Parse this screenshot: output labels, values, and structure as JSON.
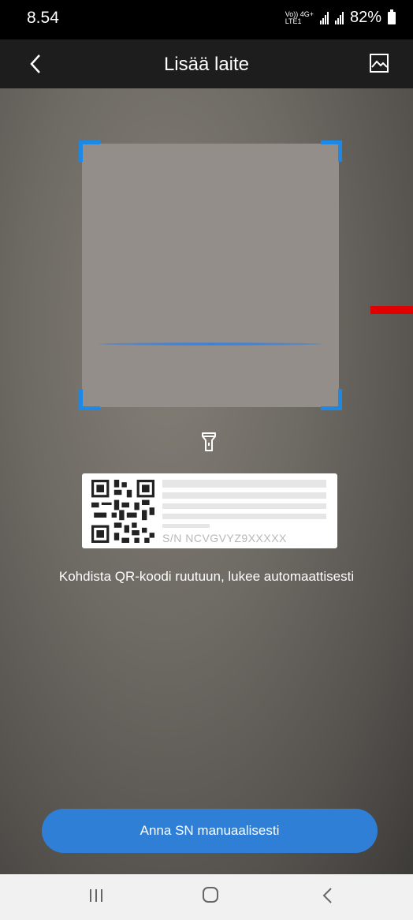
{
  "status_bar": {
    "time": "8.54",
    "network_top": "Vo)) 4G+",
    "network_bottom": "LTE1",
    "battery": "82%"
  },
  "app_bar": {
    "title": "Lisää laite",
    "back_icon": "chevron-left-icon",
    "gallery_icon": "image-icon"
  },
  "scanner": {
    "flashlight_icon": "flashlight-icon"
  },
  "sample_label": {
    "sn_text": "S/N  NCVGVYZ9XXXXX"
  },
  "hint": {
    "text": "Kohdista QR-koodi ruutuun, lukee automaattisesti"
  },
  "manual_button": {
    "label": "Anna SN manuaalisesti"
  },
  "nav": {
    "recents_icon": "recents-icon",
    "home_icon": "home-icon",
    "back_icon": "back-icon"
  },
  "colors": {
    "accent": "#1e88e5",
    "button": "#2f7fd7",
    "marker": "#e00000"
  }
}
